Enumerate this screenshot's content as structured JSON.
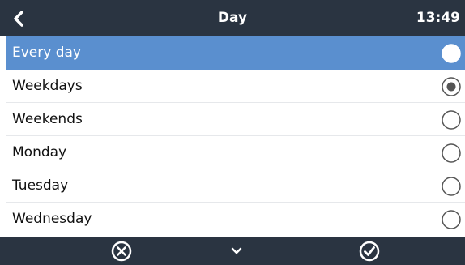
{
  "header": {
    "title": "Day",
    "time": "13:49",
    "back_icon": "chevron-left-icon"
  },
  "options": [
    {
      "label": "Every day",
      "state": "highlighted"
    },
    {
      "label": "Weekdays",
      "state": "checked"
    },
    {
      "label": "Weekends",
      "state": "unchecked"
    },
    {
      "label": "Monday",
      "state": "unchecked"
    },
    {
      "label": "Tuesday",
      "state": "unchecked"
    },
    {
      "label": "Wednesday",
      "state": "unchecked"
    }
  ],
  "footer": {
    "cancel_icon": "circle-x-icon",
    "more_icon": "chevron-down-icon",
    "confirm_icon": "circle-check-icon"
  },
  "colors": {
    "bar_background": "#2a3441",
    "highlight": "#5a8fcf",
    "row_divider": "#e6e8eb"
  }
}
